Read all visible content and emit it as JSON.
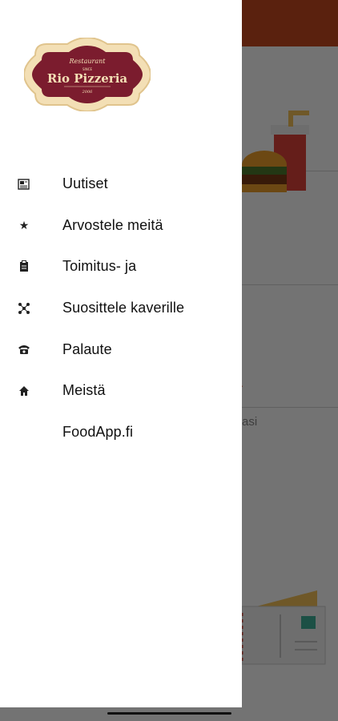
{
  "background": {
    "section_title": "toria",
    "section_subtitle": "historiasi"
  },
  "drawer": {
    "logo": {
      "top_text": "Restaurant",
      "name": "Rio Pizzeria",
      "since": "SINCE",
      "year": "2006"
    },
    "items": [
      {
        "label": "Uutiset",
        "icon": "newspaper-icon"
      },
      {
        "label": "Arvostele meitä",
        "icon": "star-icon"
      },
      {
        "label": "Toimitus- ja",
        "icon": "clipboard-icon"
      },
      {
        "label": "Suosittele kaverille",
        "icon": "share-icon"
      },
      {
        "label": "Palaute",
        "icon": "phone-icon"
      },
      {
        "label": "Meistä",
        "icon": "home-icon"
      },
      {
        "label": "FoodApp.fi",
        "icon": ""
      }
    ]
  },
  "colors": {
    "brand": "#7b1c2e",
    "accent": "#d9462b",
    "logo_bg": "#f3dfb5"
  }
}
